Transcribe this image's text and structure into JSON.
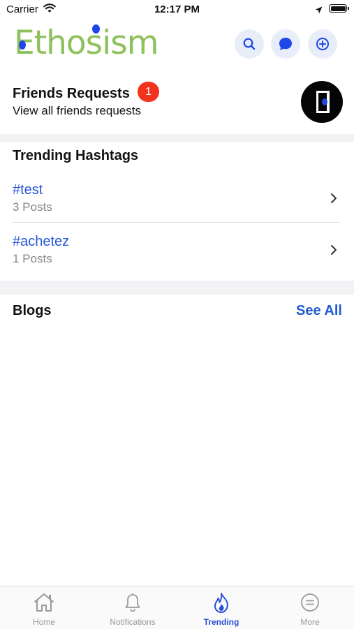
{
  "status_bar": {
    "carrier": "Carrier",
    "time": "12:17 PM"
  },
  "header": {
    "logo_text": "Ethosism",
    "logo_color": "#8dc15b",
    "accent_color": "#1f46e6",
    "icons": [
      "search-icon",
      "chat-icon",
      "add-circle-icon"
    ]
  },
  "friends": {
    "title": "Friends Requests",
    "badge_count": "1",
    "subtitle": "View all friends requests"
  },
  "trending": {
    "title": "Trending Hashtags",
    "items": [
      {
        "tag": "#test",
        "posts": "3 Posts"
      },
      {
        "tag": "#achetez",
        "posts": "1 Posts"
      }
    ]
  },
  "blogs": {
    "title": "Blogs",
    "see_all": "See All"
  },
  "tabbar": {
    "tabs": [
      {
        "label": "Home",
        "icon": "home-icon"
      },
      {
        "label": "Notifications",
        "icon": "bell-icon"
      },
      {
        "label": "Trending",
        "icon": "flame-icon",
        "active": true
      },
      {
        "label": "More",
        "icon": "menu-circle-icon"
      }
    ],
    "active_color": "#2a4fd8"
  }
}
